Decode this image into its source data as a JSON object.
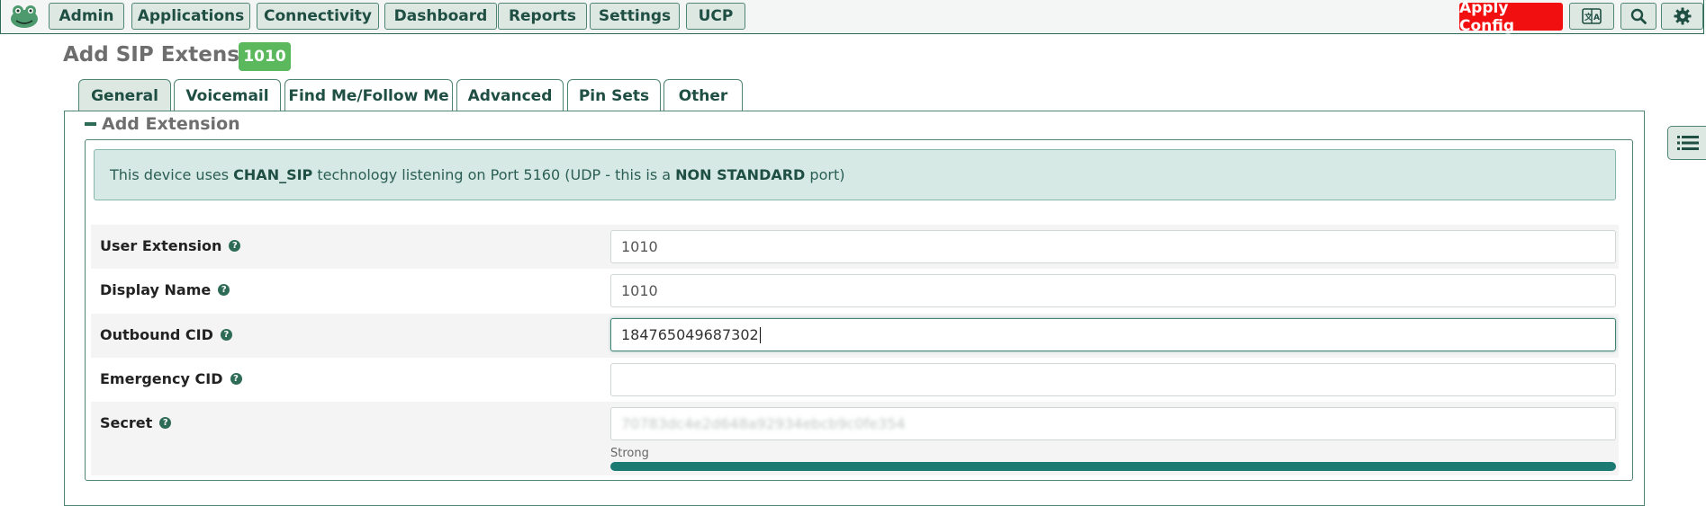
{
  "nav": {
    "items": [
      "Admin",
      "Applications",
      "Connectivity",
      "Dashboard",
      "Reports",
      "Settings",
      "UCP"
    ],
    "apply_label": "Apply Config"
  },
  "header": {
    "title": "Add SIP Extension",
    "badge": "1010"
  },
  "tabs": [
    "General",
    "Voicemail",
    "Find Me/Follow Me",
    "Advanced",
    "Pin Sets",
    "Other"
  ],
  "active_tab": "General",
  "section": {
    "title": "Add Extension"
  },
  "alert": {
    "prefix": "This device uses ",
    "tech": "CHAN_SIP",
    "middle": " technology listening on Port 5160 (UDP - this is a ",
    "emph": "NON STANDARD",
    "suffix": " port)"
  },
  "fields": [
    {
      "label": "User Extension",
      "value": "1010"
    },
    {
      "label": "Display Name",
      "value": "1010"
    },
    {
      "label": "Outbound CID",
      "value": "184765049687302"
    },
    {
      "label": "Emergency CID",
      "value": ""
    },
    {
      "label": "Secret",
      "value": "70783dc4e2d648a92934ebcb9c0fe354"
    }
  ],
  "strength": {
    "label": "Strong",
    "level": 1.0
  },
  "colors": {
    "accent": "#2e6b57",
    "apply": "#f20f0f",
    "badge": "#5cb85c",
    "strength": "#1b7a71"
  },
  "icons": {
    "logo": "frog-logo-icon",
    "language": "language-icon",
    "search": "search-icon",
    "settings": "gear-icon",
    "sidebar": "list-icon",
    "help": "question-circle-icon"
  }
}
